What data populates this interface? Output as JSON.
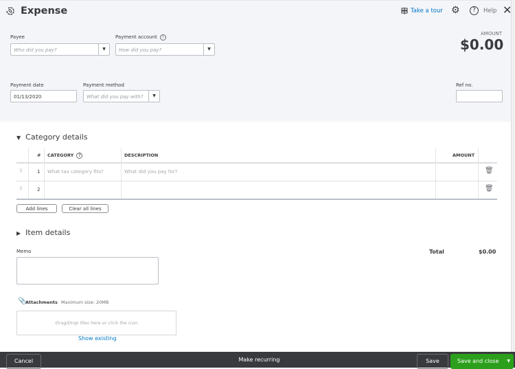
{
  "header": {
    "title": "Expense",
    "tour": "Take a tour",
    "help": "Help",
    "amount_label": "AMOUNT",
    "amount": "$0.00"
  },
  "form": {
    "payee_label": "Payee",
    "payee_placeholder": "Who did you pay?",
    "account_label": "Payment account",
    "account_placeholder": "How did you pay?",
    "date_label": "Payment date",
    "date_value": "01/13/2020",
    "method_label": "Payment method",
    "method_placeholder": "What did you pay with?",
    "ref_label": "Ref no.",
    "ref_value": ""
  },
  "category": {
    "title": "Category details",
    "headers": {
      "num": "#",
      "category": "CATEGORY",
      "description": "DESCRIPTION",
      "amount": "AMOUNT"
    },
    "rows": [
      {
        "num": "1",
        "category": "What tax category fits?",
        "description": "What did you pay for?"
      },
      {
        "num": "2",
        "category": "",
        "description": ""
      }
    ],
    "add_lines": "Add lines",
    "clear_lines": "Clear all lines"
  },
  "item_details": "Item details",
  "memo_label": "Memo",
  "total_label": "Total",
  "total_value": "$0.00",
  "attachments": {
    "label": "Attachments",
    "max": "Maximum size: 20MB",
    "drop": "Drag/Drop files here or click the icon",
    "show_existing": "Show existing"
  },
  "footer": {
    "cancel": "Cancel",
    "recurring": "Make recurring",
    "save": "Save",
    "save_close": "Save and close"
  },
  "colors": {
    "accent": "#0077c5",
    "save_close": "#2ca01c",
    "footer": "#393a3d"
  }
}
